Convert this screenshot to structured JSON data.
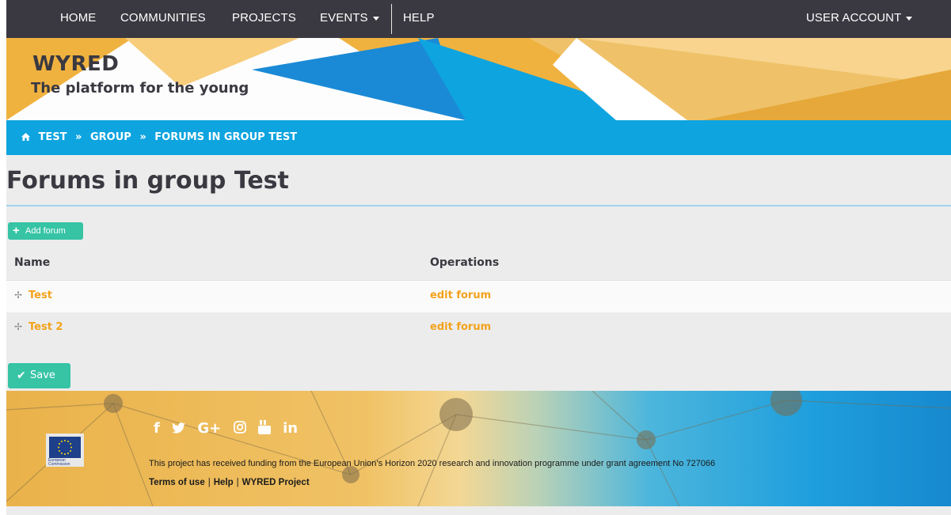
{
  "nav": {
    "home": "HOME",
    "communities": "COMMUNITIES",
    "projects": "PROJECTS",
    "events": "EVENTS",
    "help": "HELP",
    "user_account": "USER ACCOUNT"
  },
  "hero": {
    "brand": "WYRED",
    "tagline": "The platform for the young"
  },
  "breadcrumb": [
    "TEST",
    "GROUP",
    "FORUMS IN GROUP TEST"
  ],
  "page": {
    "title": "Forums in group Test",
    "add_button": "Add forum",
    "save_button": "Save"
  },
  "table": {
    "columns": [
      "Name",
      "Operations"
    ],
    "rows": [
      {
        "name": "Test",
        "operation": "edit forum"
      },
      {
        "name": "Test 2",
        "operation": "edit forum"
      }
    ]
  },
  "footer": {
    "social_icons": [
      "facebook-icon",
      "twitter-icon",
      "google-plus-icon",
      "instagram-icon",
      "youtube-icon",
      "linkedin-icon"
    ],
    "social_glyphs": [
      "f",
      "🐦",
      "G+",
      "◎",
      "▣",
      "in"
    ],
    "eu_caption_line1": "European",
    "eu_caption_line2": "Commission",
    "funding_text": "This project has received funding from the European Union’s Horizon 2020 research and innovation programme under grant agreement No 727066",
    "links": [
      "Terms of use",
      "Help",
      "WYRED Project"
    ]
  },
  "colors": {
    "nav_bg": "#3a3941",
    "breadcrumb_bg": "#0ea4df",
    "accent_green": "#36c4a5",
    "link_orange": "#f3a21a",
    "hero_gold": "#f0b23f",
    "hero_blue": "#1b8ad6"
  }
}
